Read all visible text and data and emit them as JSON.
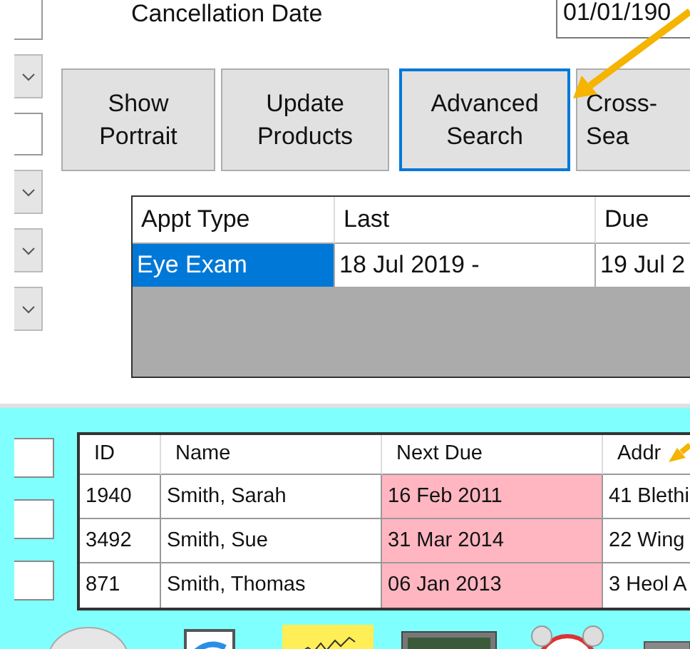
{
  "form": {
    "cancellation_label": "Cancellation Date",
    "cancellation_date": "01/01/190"
  },
  "side_controls": [
    {
      "kind": "field"
    },
    {
      "kind": "combo"
    },
    {
      "kind": "field"
    },
    {
      "kind": "combo"
    },
    {
      "kind": "combo"
    },
    {
      "kind": "combo"
    }
  ],
  "buttons": [
    {
      "lines": [
        "Show",
        "Portrait"
      ],
      "focused": false
    },
    {
      "lines": [
        "Update",
        "Products"
      ],
      "focused": false
    },
    {
      "lines": [
        "Advanced",
        "Search"
      ],
      "focused": true
    },
    {
      "lines": [
        "Cross-",
        "Sea"
      ],
      "focused": false
    }
  ],
  "appointments": {
    "columns": [
      "Appt Type",
      "Last",
      "Due"
    ],
    "rows": [
      {
        "cells": [
          {
            "text": "Eye Exam",
            "selected": true
          },
          {
            "text": "18 Jul 2019 -",
            "selected": false
          },
          {
            "text": "19 Jul 2",
            "selected": false
          }
        ]
      }
    ]
  },
  "search_fields": [
    {
      "kind": "field"
    },
    {
      "kind": "field"
    },
    {
      "kind": "field"
    }
  ],
  "results": {
    "columns": [
      "ID",
      "Name",
      "Next Due",
      "Addr"
    ],
    "rows": [
      {
        "cells": [
          {
            "text": "1940",
            "highlighted": false
          },
          {
            "text": "Smith, Sarah",
            "highlighted": false
          },
          {
            "text": "16 Feb 2011",
            "highlighted": true
          },
          {
            "text": "41 Blethi",
            "highlighted": false
          }
        ]
      },
      {
        "cells": [
          {
            "text": "3492",
            "highlighted": false
          },
          {
            "text": "Smith, Sue",
            "highlighted": false
          },
          {
            "text": "31 Mar 2014",
            "highlighted": true
          },
          {
            "text": "22 Wing",
            "highlighted": false
          }
        ]
      },
      {
        "cells": [
          {
            "text": "871",
            "highlighted": false
          },
          {
            "text": "Smith, Thomas",
            "highlighted": false
          },
          {
            "text": "06 Jan 2013",
            "highlighted": true
          },
          {
            "text": "3 Heol A",
            "highlighted": false
          }
        ]
      }
    ]
  }
}
